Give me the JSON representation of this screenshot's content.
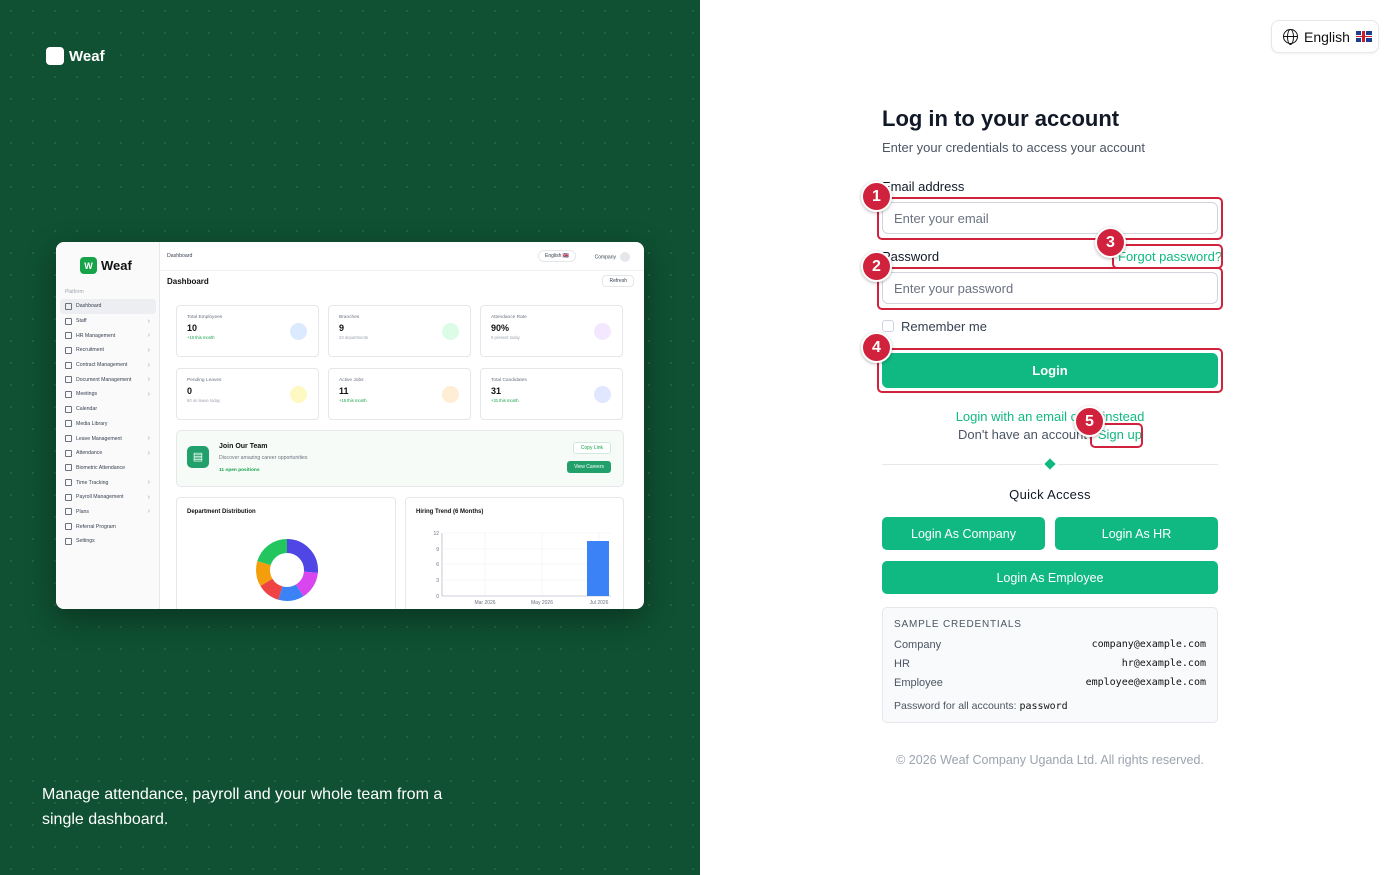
{
  "brand": {
    "name": "Weaf"
  },
  "tagline": "Manage attendance, payroll and your whole team from a single dashboard.",
  "preview": {
    "logo": "Weaf",
    "logo_letter": "W",
    "platform_label": "Platform",
    "nav": [
      "Dashboard",
      "Staff",
      "HR Management",
      "Recruitment",
      "Contract Management",
      "Document Management",
      "Meetings",
      "Calendar",
      "Media Library",
      "Leave Management",
      "Attendance",
      "Biometric Attendance",
      "Time Tracking",
      "Payroll Management",
      "Plans",
      "Referral Program",
      "Settings"
    ],
    "breadcrumb": "Dashboard",
    "language": "English 🇬🇧",
    "company": "Company",
    "title": "Dashboard",
    "refresh": "Refresh",
    "stats": [
      {
        "label": "Total Employees",
        "value": "10",
        "sub": "+10 this month",
        "color": "#dbeafe"
      },
      {
        "label": "Branches",
        "value": "9",
        "sub": "23 departments",
        "color": "#dcfce7"
      },
      {
        "label": "Attendance Rate",
        "value": "90%",
        "sub": "9 present today",
        "color": "#f3e8ff"
      },
      {
        "label": "Pending Leaves",
        "value": "0",
        "sub": "60 on leave today",
        "color": "#fef9c3"
      },
      {
        "label": "Active Jobs",
        "value": "11",
        "sub": "+15 this month",
        "color": "#ffedd5"
      },
      {
        "label": "Total Candidates",
        "value": "31",
        "sub": "+31 this month",
        "color": "#e0e7ff"
      }
    ],
    "join": {
      "title": "Join Our Team",
      "desc": "Discover amazing career opportunities",
      "open": "11 open positions",
      "copy": "Copy Link",
      "view": "View Careers"
    },
    "dept_title": "Department Distribution",
    "hiring_title": "Hiring Trend (6 Months)",
    "hiring_y_ticks": [
      "12",
      "9",
      "6",
      "3",
      "0"
    ],
    "hiring_x_ticks": [
      "Mar 2026",
      "May 2026",
      "Jul 2026"
    ]
  },
  "language_button": {
    "label": "English"
  },
  "login": {
    "title": "Log in to your account",
    "subtitle": "Enter your credentials to access your account",
    "email_label": "Email address",
    "email_placeholder": "Enter your email",
    "password_label": "Password",
    "forgot": "Forgot password?",
    "password_placeholder": "Enter your password",
    "remember": "Remember me",
    "login_button": "Login",
    "alt_login": "Login with an email code instead",
    "no_account": "Don't have an account?",
    "signup": "Sign up"
  },
  "quick_access": {
    "title": "Quick Access",
    "company": "Login As Company",
    "hr": "Login As HR",
    "employee": "Login As Employee"
  },
  "sample_credentials": {
    "title": "SAMPLE CREDENTIALS",
    "rows": [
      {
        "role": "Company",
        "email": "company@example.com"
      },
      {
        "role": "HR",
        "email": "hr@example.com"
      },
      {
        "role": "Employee",
        "email": "employee@example.com"
      }
    ],
    "password_note": "Password for all accounts:",
    "password_value": "password"
  },
  "footer": "© 2026 Weaf Company Uganda Ltd. All rights reserved.",
  "annotations": [
    "1",
    "2",
    "3",
    "4",
    "5"
  ],
  "colors": {
    "accent": "#10b981",
    "panel": "#0f5132",
    "highlight": "#d0223c"
  }
}
